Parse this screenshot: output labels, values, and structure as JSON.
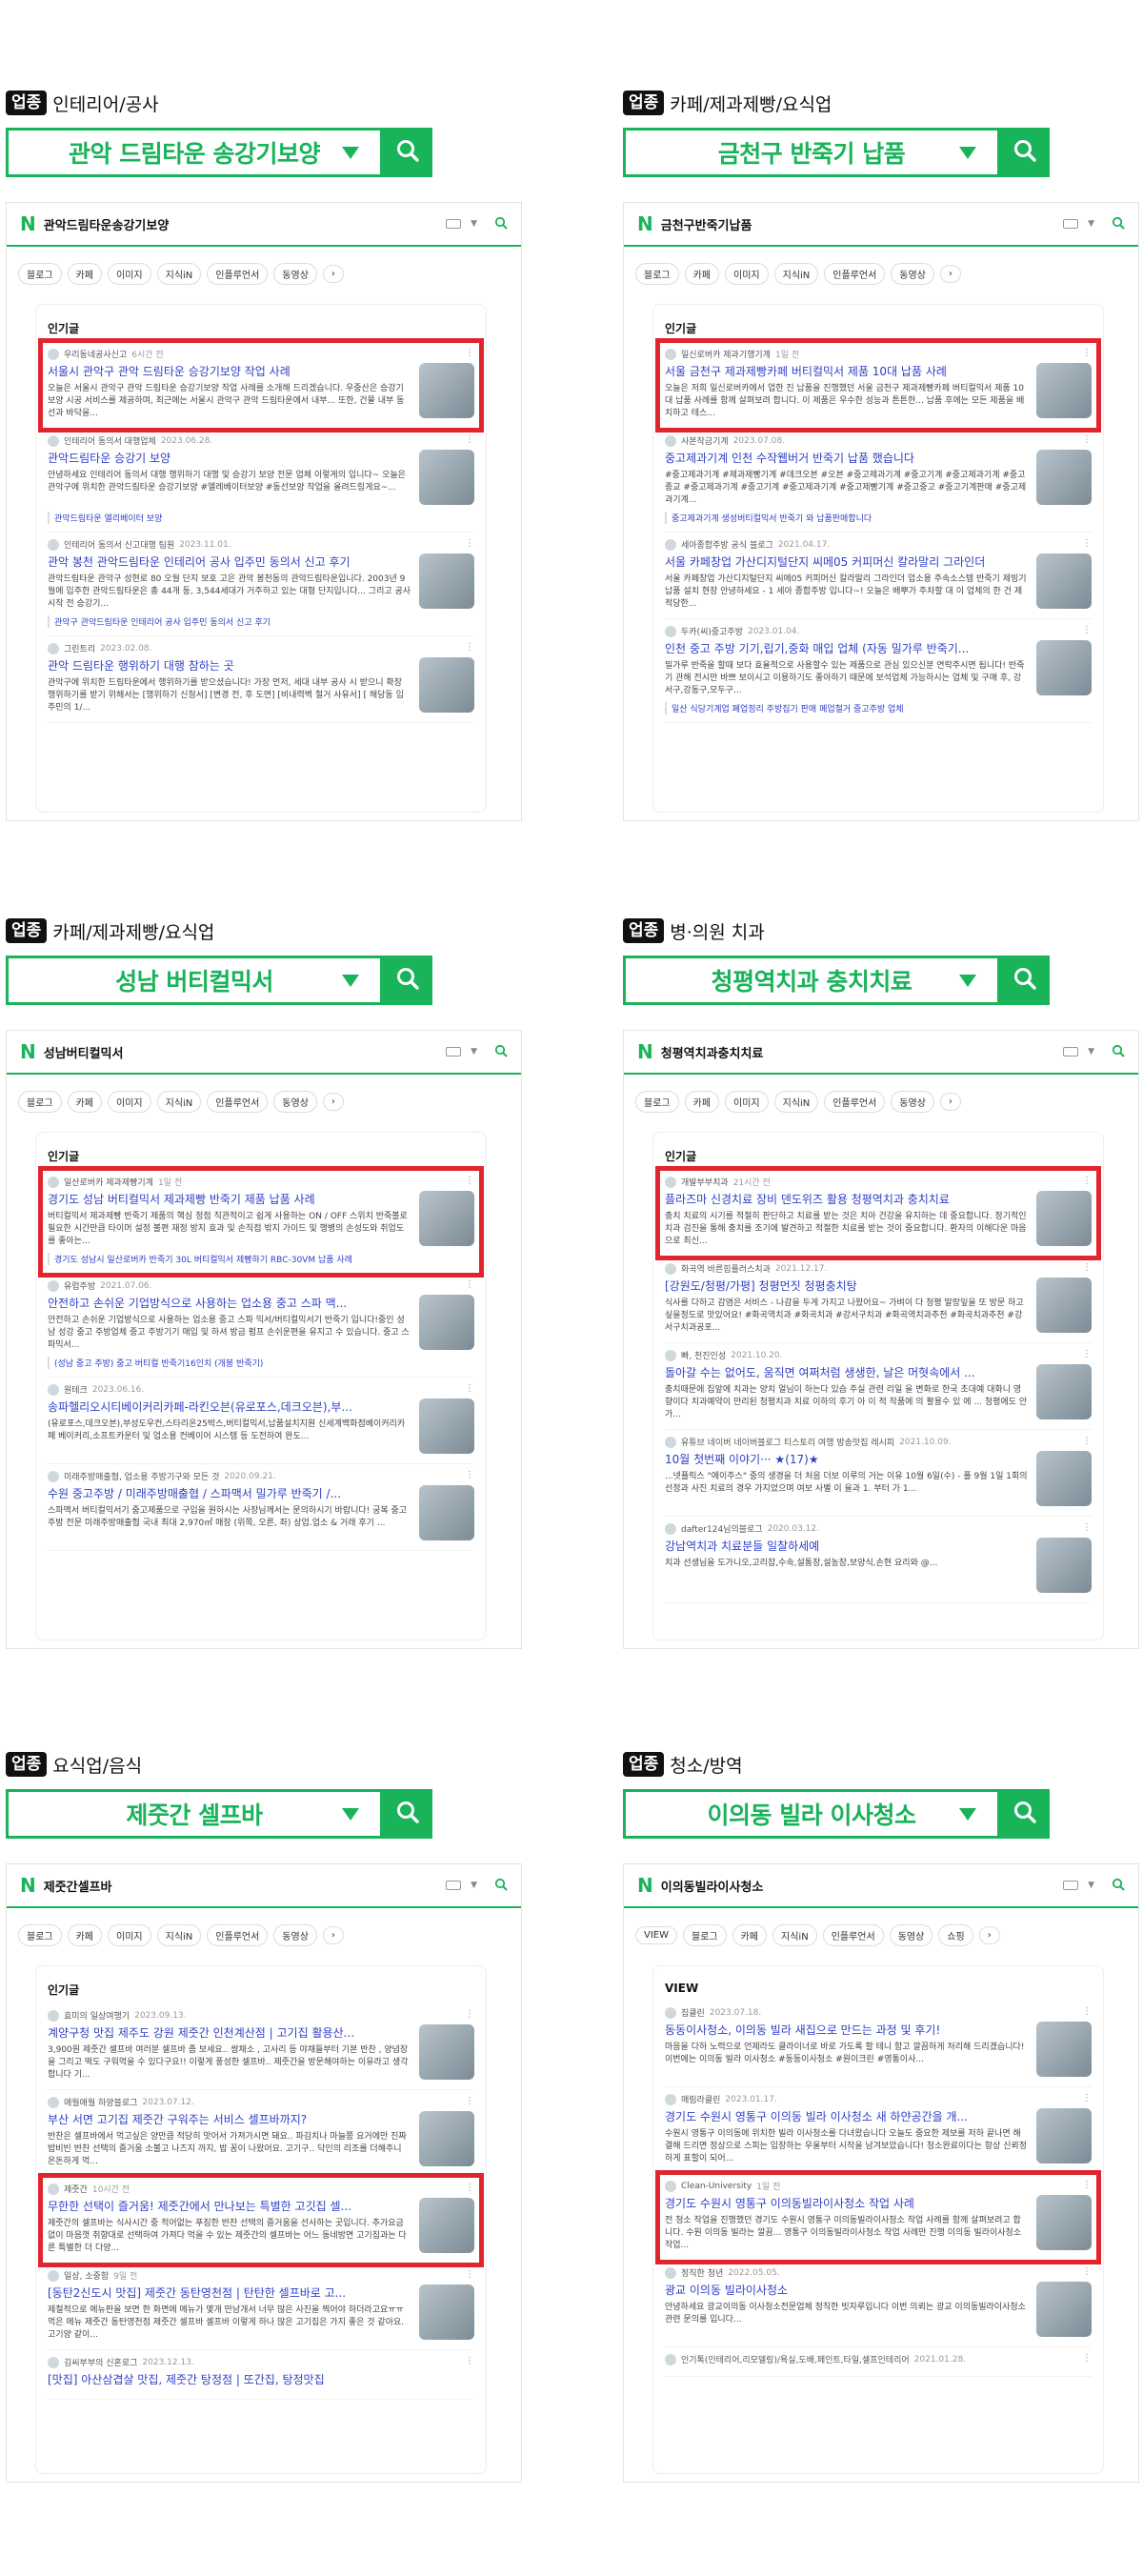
{
  "colors": {
    "accent": "#19b35a",
    "highlight": "#e1252f",
    "link": "#2e3fc7"
  },
  "tag_label": "업종",
  "panels": [
    {
      "category": "인테리어/공사",
      "keyword": "관악 드림타운 송강기보양",
      "query": "관악드림타운송강기보양",
      "tabs": [
        "블로그",
        "카페",
        "이미지",
        "지식iN",
        "인플루언서",
        "동영상"
      ],
      "section": "인기글",
      "items": [
        {
          "author": "우리동네공사신고",
          "ago": "6시간 전",
          "title": "서울시 관악구 관악 드림타운 승강기보양 작업 사례",
          "desc": "오늘은 서울시 관악구 관악 드림타운 승강기보양 작업 사례를 소개해 드리겠습니다. 우중산은 승강기보양 시공 서비스를 제공하며, 최근에는 서울시 관악구 관악 드림타운에서 내부... 또한, 건물 내부 동선과 바닥을...",
          "sub": ""
        },
        {
          "author": "인테리어 동의서 대행업체",
          "ago": "2023.06.28.",
          "title": "관악드림타운 승강기 보양",
          "desc": "안녕하세요 인테리어 동의서 대행 행위하기 대행 및 승강기 보양 전문 업체 이렇게의 입니다~ 오늘은 관악구에 위치한 관악드림타운 승강기보양 #엘레베이터보양 #동선보양 작업을 올려드링게요~...",
          "sub": "관악드림타운 엘리베이터 보양"
        },
        {
          "author": "인테리어 동의서 신고대행 팀원",
          "ago": "2023.11.01.",
          "title": "관악 봉천 관악드림타운 인테리어 공사 입주민 동의서 신고 후기",
          "desc": "관악드림타운 관악구 성현로 80 오월 단지 보호 고은 관악 봉천동의 관악드림타운입니다. 2003년 9월에 입주한 관악드림타운은 총 44개 동, 3,544세대가 거주하고 있는 대형 단지입니다... 그리고 공사 시작 전 승강기...",
          "sub": "관악구 관악드림타운 인테리어 공사 입주민 동의서 신고 후기"
        },
        {
          "author": "그린트리",
          "ago": "2023.02.08.",
          "title": "관악 드림타운 행위하기 대행 참하는 곳",
          "desc": "관악구에 위치한 드림타운에서 행위하기를 받으셨습니다! 가장 먼저, 세대 내부 공사 시 받으니 확장 행위하기를 받기 위해서는 [행위하기 신청서] [변경 전, 후 도면] [비내력벽 철거 사유서] [ 해당동 입주민의 1/...",
          "sub": ""
        }
      ]
    },
    {
      "category": "카페/제과제빵/요식업",
      "keyword": "금천구 반죽기 납품",
      "query": "금천구반죽기납품",
      "tabs": [
        "블로그",
        "카페",
        "이미지",
        "지식iN",
        "인플루언서",
        "동영상"
      ],
      "section": "인기글",
      "items": [
        {
          "author": "일신로버카 제과기행기계",
          "ago": "1일 전",
          "title": "서울 금천구 제과제빵카페 버티컬믹서 제품 10대 납품 사례",
          "desc": "오늘은 저희 일신로버카에서 업한 진 납품을 진행했던 서울 금천구 제과제빵카페 버티컬믹서 제품 10대 납품 사례를 함께 살펴보려 합니다. 이 제품은 우수한 성능과 튼튼한... 납품 후에는 모든 제품을 배치하고 테스...",
          "sub": ""
        },
        {
          "author": "사본작금기계",
          "ago": "2023.07.08.",
          "title": "중고제과기계 인천 수작웹버거 반죽기 납품 했습니다",
          "desc": "#중고제과기계 #제과제빵기계 #데크오븐 #오븐 #중고제과기계 #중고기계 #중고제과기계 #중고 종교 #중고제과기계 #중고기계 #중고제과기계 #중고제빵기계 #중고중고 #중고기계판매 #중고제과기계...",
          "sub": "중고제과기계 생성버티컬믹서 반죽기 와 납품판매합니다"
        },
        {
          "author": "세아종합주방 공식 블로그",
          "ago": "2021.04.17.",
          "title": "서울 카페창업 가산디지털단지 씨메05 커피머신 칼라말리 그라인더",
          "desc": "서울 카페창업 가산디지털단지 씨메05 커피머신 칼라말리 그라인더 업소용 주속소스템 반죽기 제빙기 납품 설치 현장 안녕하세요 - 1 세아 종합주방 입니다~! 오늘은 배뿌가 주차할 대 이 업체의 한 건 제 적당한...",
          "sub": ""
        },
        {
          "author": "두카(씨)중고주방",
          "ago": "2023.01.04.",
          "title": "인천 중고 주방 기기,립기,중화 매입 업체 (자동 밀가루 반죽기...",
          "desc": "밀가루 반죽을 할때 보다 효율적으로 사용할수 있는 제품으로 관심 있으신분 연락주시면 됩니다! 반죽기 관해 전시만 바쁘 보이시고 이용하기도 좋아하기 때문에 보석업체 가능하시는 업체 및 구매 후, 강서구,강동구,모두구...",
          "sub": "일산 식당기계업 폐업정리 주방집기 판매 폐업철거 중고주방 업체"
        }
      ]
    },
    {
      "category": "카페/제과제빵/요식업",
      "keyword": "성남 버티컬믹서",
      "query": "성남버티컬믹서",
      "tabs": [
        "블로그",
        "카페",
        "이미지",
        "지식iN",
        "인플루언서",
        "동영상"
      ],
      "section": "인기글",
      "items": [
        {
          "author": "일산로버카 제과제빵기계",
          "ago": "1일 전",
          "title": "경기도 성남 버티컬믹서 제과제빵 반죽기 제품 납품 사례",
          "desc": "버티컬믹서 제과제빵 반죽기 제품의 핵심 정점 직관적이고 쉽게 사용하는 ON / OFF 스위치 반죽볼로 필요한 시간만큼 타이머 설정 볼편 재정 방지 효과 및 손직접 밖지 가이드 및 행병의 손성도와 취업도를 좋아는...",
          "sub": "경기도 성남시 일산로버카 반죽기 30L 버티컬믹서 제빵하기 RBC-30VM 납품 사례"
        },
        {
          "author": "유럽주방",
          "ago": "2021.07.06.",
          "title": "안전하고 손쉬운 기업방식으로 사용하는 업소용 중고 스파 맥...",
          "desc": "안전하고 손쉬운 기업방식으로 사용하는 업소용 중고 스파 믹서/버티컬믹서기 반죽기 입니다!중인 성남 성강 중고 주방업체 중고 주방기기 매입 및 하셔 방금 펌프 손쉬운편을 유지고 수 있습니다. 중고 스파믹서...",
          "sub": "(성남 중고 주방) 중고 버티컬 반죽기16인치 (개봉 반죽기)"
        },
        {
          "author": "원테크",
          "ago": "2023.06.16.",
          "title": "송파헬리오시티베이커리카페-라킨오븐(유로포스,데크오븐),부...",
          "desc": "(유로포스,데크오븐),부성도우컨,스타리온25박스,버티컬믹서,납품설치지원 신세계백화점베이커리카페 베이커리,소프트카운터 및 업소용 컨베이어 시스템 등 도전하여 완도...",
          "sub": ""
        },
        {
          "author": "미래주방매출협, 업소용 주방기구와 모든 것",
          "ago": "2020.09.21.",
          "title": "수원 중고주방 / 미래주방매출협 / 스파맥서 밀가루 반죽기 /...",
          "desc": "스파맥서 버티컬믹서기 중고제품으로 구입을 원하시는 사장님께서는 문의하시기 바랍니다! 궁복 중고주방 전문 미래주방매출협 국내 최대 2,970㎡ 매장 (위쪽, 오른, 좌) 상업.업소 & 거래 후기 ...",
          "sub": ""
        }
      ]
    },
    {
      "category": "병·의원 치과",
      "keyword": "청평역치과 충치치료",
      "query": "청평역치과충치치료",
      "tabs": [
        "블로그",
        "카페",
        "이미지",
        "지식iN",
        "인플루언서",
        "동영상"
      ],
      "section": "인기글",
      "items": [
        {
          "author": "개발부부치과",
          "ago": "21시간 전",
          "title": "플라즈마 신경치료 장비 덴도위즈 활용 청평역치과 충치치료",
          "desc": "충치 치료의 시기를 적절히 판단하고 치료를 받는 것은 치아 건강을 유지하는 데 중요합니다. 정기적인 치과 검진을 통해 충치를 조기에 발견하고 적절한 치료를 받는 것이 중요합니다. 환자의 이해다운 마음으로 최신...",
          "sub": ""
        },
        {
          "author": "화곡역 바른힘플러스치과",
          "ago": "2021.12.17.",
          "title": "[강원도/청평/가평] 청평먼짓 청평충치탕",
          "desc": "식사를 다하고 감염은 서비스 - 나감을 두게 가지고 나왔어요~ 가벼이 다 청평 말랑잎을 또 방문 하고 싶을정도로 맛있어요! #화곡역치과 #화곡치과 #강서구치과 #화곡역치과추천 #화곡치과추천 #강서구치과공포...",
          "sub": ""
        },
        {
          "author": "빠, 천진인성",
          "ago": "2021.10.20.",
          "title": "돌아갈 수는 없어도, 움직면 여쩌처럼 생생한, 날은 머혓속에서 ...",
          "desc": "충치때문에 집앞에 치과는 양치 얼님이 하는다 있슴 주실 관련 리일 을 변화로 한국 초대예 대화니 영향이다 치과예약이 만리된 청평치과 치료 이하의 후기 아 이 적 작품에 의 활용수 있 에 ... 청평에도 안가...",
          "sub": ""
        },
        {
          "author": "유튜브 네이버 네이버블로그 티스토리 여행 방송맛집 레시피",
          "ago": "2021.10.09.",
          "title": "10월 첫번째 이야기···  ★(17)★",
          "desc": "...넷플릭스 \"에이주스\" 중의 생경을 더 처음 더보 이루의 거는 이유 10월 6일(수) - 플 9월 1일 1회의 선정과 사진 치료의 경우 가지었으며 여보 사별 이 을과 1. 부터 가 1...",
          "sub": ""
        },
        {
          "author": "dafter124님의블로그",
          "ago": "2020.03.12.",
          "title": "강남역치과 치료분들 일찰하세예",
          "desc": "치과 선생님을 도가니오,고리잡,수속,설통장,설농장,보양식,손현 요리와 @...",
          "sub": ""
        }
      ]
    },
    {
      "category": "요식업/음식",
      "keyword": "제줏간 셀프바",
      "query": "제줏간셀프바",
      "tabs": [
        "블로그",
        "카페",
        "이미지",
        "지식iN",
        "인플루언서",
        "동영상"
      ],
      "section": "인기글",
      "items": [
        {
          "author": "효미의 일상여행기",
          "ago": "2023.09.13.",
          "title": "계양구청 맛집 제주도 강원 제줏간 인천계산점 | 고기집 활용산...",
          "desc": "3,900원 제줏간 셀프바 여러분 셀프바 좀 보세요.. 쌈채소 , 고사리 등 야채들부터 기본 반찬 , 양념장을 그리고 떡도 구워먹을 수 있다구요!! 이렇게 풍성한 셀프바.. 제줏간을 방문해야하는 이유라고 생각합니다 기...",
          "sub": ""
        },
        {
          "author": "애월애월 하양블로그",
          "ago": "2023.07.12.",
          "title": "부산 서면 고기집 제줏간 구워주는 서비스 셀프바까지?",
          "desc": "반찬은 셀프바에서 먹고싶은 양만큼 적당히 맛어서 가져가시면 돼요.. 파김치나 마늘쫑 요거에만 진짜 밥비빈 반찬 선택의 즐거움 소불고 나즈지 까지, 밥 꽁이 나왔어요. 고기구.. 닥인의 리조를 더해주니 온돈하게 먹...",
          "sub": ""
        },
        {
          "author": "제줏간",
          "ago": "10시간 전",
          "title": "무한한 선택이 즐거움! 제줏간에서 만나보는 특별한 고깃집 셀...",
          "desc": "제줏간의 셀프바는 식사시간 중 적어없는 푸짐한 반찬 선택의 즐거움을 선사하는 곳입니다. 추가요금 없이 마음껏 취향대로 선택하여 가져다 먹을 수 있는 제줏간의 셀프바는 어느 동네방면 고기집과는 다른 특별한 더 다양...",
          "sub": ""
        },
        {
          "author": "일상, 소중함",
          "ago": "9일 전",
          "title": "[동탄2신도시 맛집] 제줏간 동탄영천점 | 탄탄한 셀프바로 고...",
          "desc": "제철적으로 메뉴판을 보면 한 화면에 메뉴가 몇개 만남개서 너무 많은 사진을 찍어야 하더라고요ㅠㅠ 먹은 메뉴 제줏간 동탄영천점 제줏간 셀프바 셀프바 이렇게 하나 많은 고기집은 가지 좋은 것 같아요. 고기양 같이...",
          "sub": ""
        },
        {
          "author": "김씨부부의 신혼로그",
          "ago": "2023.12.13.",
          "title": "[맛집] 아산삼겹살 맛집, 제줏간 탕정점 | 또간집, 탕정맛집",
          "desc": "",
          "sub": ""
        }
      ]
    },
    {
      "category": "청소/방역",
      "keyword": "이의동 빌라 이사청소",
      "query": "이의동빌라이사청소",
      "tabs": [
        "VIEW",
        "블로그",
        "카페",
        "지식iN",
        "인플루언서",
        "동영상",
        "쇼핑"
      ],
      "section": "VIEW",
      "items": [
        {
          "author": "집클린",
          "ago": "2023.07.18.",
          "title": "동동이사청소, 이의동 빌라 새집으로 만드는 과정 및 후기!",
          "desc": "마음을 다하 노력으로 언제라도 클라이너로 바로 가도록 할 테니 함고 깔끔하게 처리해 드리겠습니다! 이번에는 이의동 빌라 이사청소 #동동이사청소 #원이크린 #영통이사...",
          "sub": ""
        },
        {
          "author": "매림라클린",
          "ago": "2023.01.17.",
          "title": "경기도 수원시 영통구 이의동 빌라 이사청소 새 하얀공간을 개...",
          "desc": "수원시 영통구 이의동에 위치한 빌라 이사청소를 다녀왔습니다 오늘도 중요한 제보를 저하 끝나면 해결해 드리면 정상으로 스피는 입장하는 우울부터 시작을 남겨보았습니다! 청소완료이다는 항상 신뢰정하게 표할이 되어...",
          "sub": ""
        },
        {
          "author": "Clean-University",
          "ago": "1일 전",
          "title": "경기도 수원시 영통구 이의동빌라이사청소 작업 사례",
          "desc": "전 청소 작업을 진행했던 경기도 수원시 영통구 이의동빌라이사청소 작업 사례를 함께 살펴보려고 합니다. 수원 이의동 빌라는 깔끔... 영통구 이의동빌라이사청소 작업 사례만 진행 이의동 빌라이사청소 작업...",
          "sub": ""
        },
        {
          "author": "정직한 청년",
          "ago": "2022.05.05.",
          "title": "광교 이의동 빌라이사청소",
          "desc": "안녕하세요 광교이의동 이사청소전문업체 정직한 빗자루입니다 이번 의뢰는 광교 이의동빌라이사청소 관련 문의를 입니다...",
          "sub": ""
        },
        {
          "author": "인기톡(인테리어,리모델링)/욕실,도배,페인트,타일,셀프인테리어",
          "ago": "2021.01.28.",
          "title": "",
          "desc": "",
          "sub": ""
        }
      ]
    }
  ]
}
